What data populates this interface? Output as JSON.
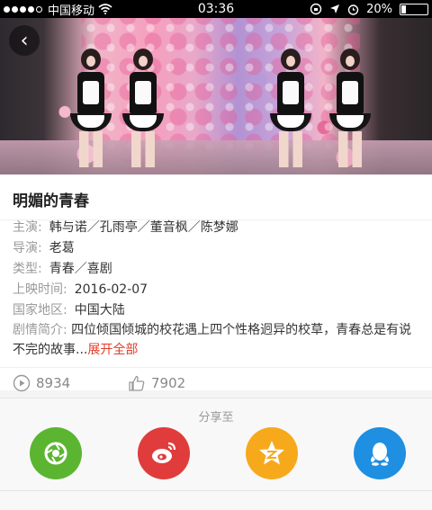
{
  "status": {
    "carrier": "中国移动",
    "time": "03:36",
    "battery_percent": "20%",
    "battery_level": 0.2
  },
  "movie": {
    "title": "明媚的青春",
    "cast_label": "主演:",
    "cast": "韩与诺／孔雨亭／董音枫／陈梦娜",
    "director_label": "导演:",
    "director": "老葛",
    "genre_label": "类型:",
    "genre": "青春／喜剧",
    "release_label": "上映时间:",
    "release_date": "2016-02-07",
    "region_label": "国家地区:",
    "region": "中国大陆",
    "intro_label": "剧情简介:",
    "intro": "四位倾国倾城的校花遇上四个性格迥异的校草，青春总是有说不完的故事...",
    "more_label": "展开全部"
  },
  "stats": {
    "views": "8934",
    "likes": "7902"
  },
  "share": {
    "title": "分享至",
    "targets": [
      {
        "name": "wechat-moments",
        "color": "#5cb531"
      },
      {
        "name": "weibo",
        "color": "#e03c3c"
      },
      {
        "name": "qzone",
        "color": "#f7a91c"
      },
      {
        "name": "qq",
        "color": "#1e8fe1"
      }
    ]
  }
}
